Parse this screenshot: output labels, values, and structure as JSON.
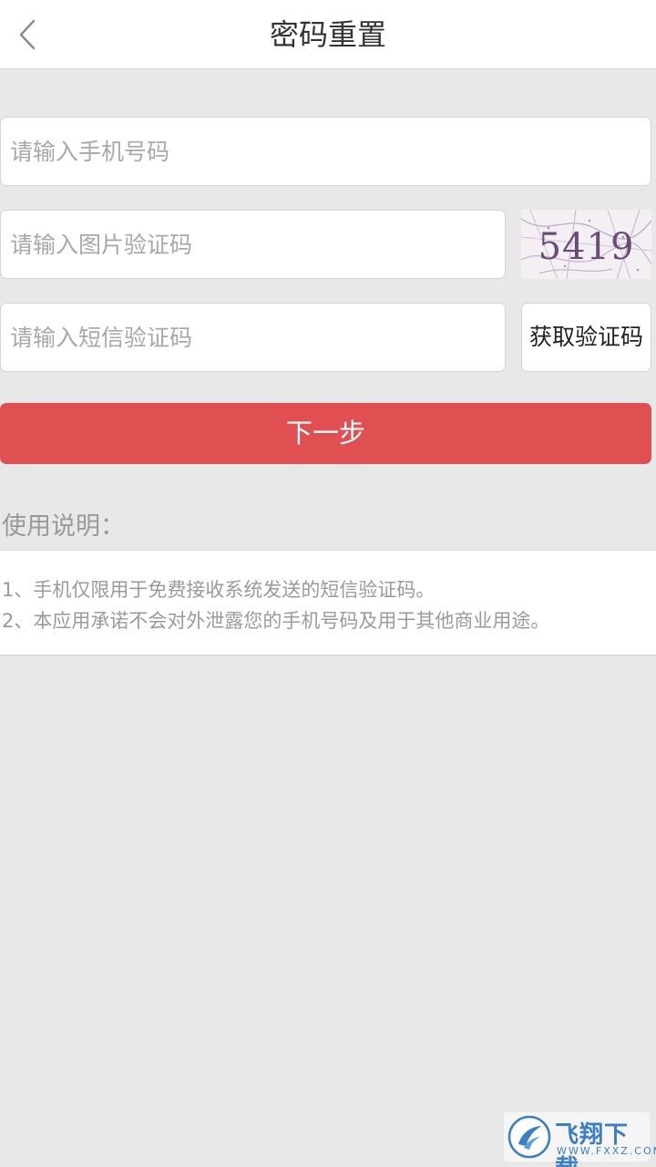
{
  "header": {
    "title": "密码重置",
    "back_icon": "chevron-left-icon"
  },
  "form": {
    "phone_placeholder": "请输入手机号码",
    "image_code_placeholder": "请输入图片验证码",
    "captcha_text": "5419",
    "sms_code_placeholder": "请输入短信验证码",
    "get_sms_code_label": "获取验证码",
    "next_label": "下一步"
  },
  "usage": {
    "title": "使用说明：",
    "lines": [
      "1、手机仅限用于免费接收系统发送的短信验证码。",
      "2、本应用承诺不会对外泄露您的手机号码及用于其他商业用途。"
    ]
  },
  "watermark": {
    "text": "飞翔下载",
    "sub": "WWW.FXXZ.COM"
  },
  "colors": {
    "accent": "#e04f51",
    "background": "#e8e8e8",
    "placeholder": "#a8a8a8"
  }
}
